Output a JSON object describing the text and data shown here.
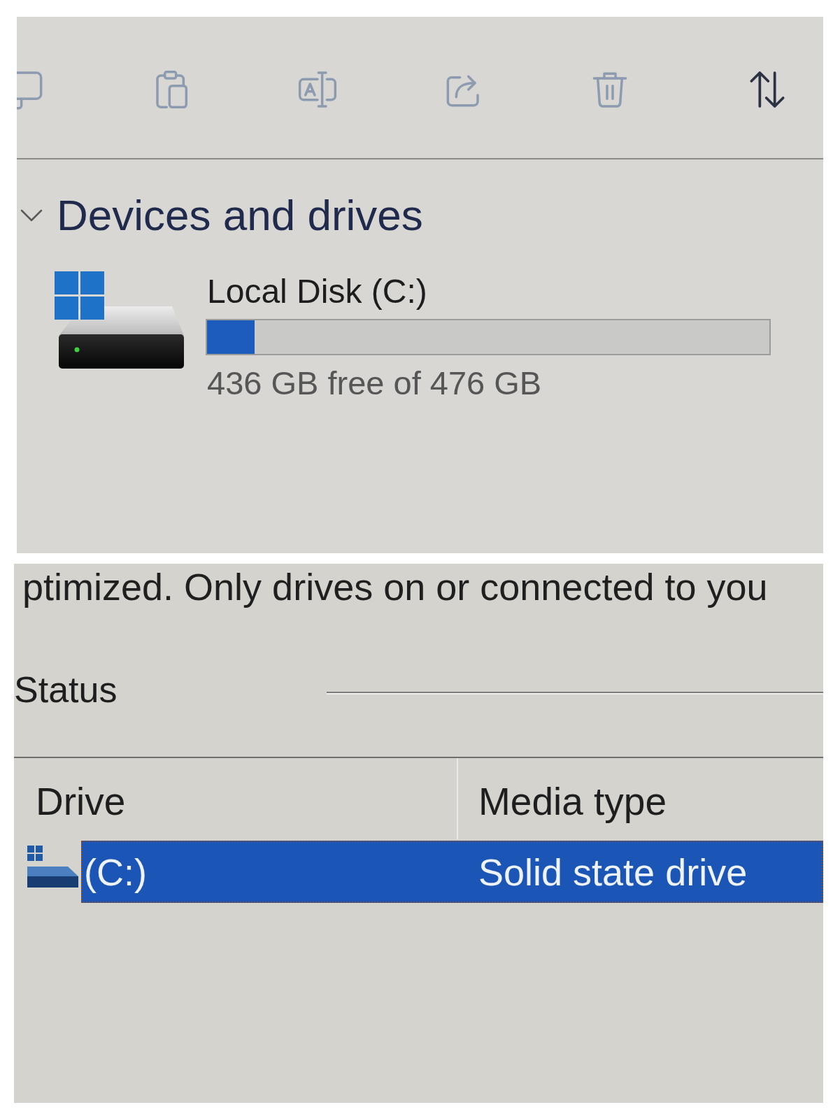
{
  "top_panel": {
    "toolbar": [
      {
        "kind": "copy",
        "disabled": true
      },
      {
        "kind": "paste",
        "disabled": true
      },
      {
        "kind": "rename",
        "disabled": true
      },
      {
        "kind": "share",
        "disabled": true
      },
      {
        "kind": "delete",
        "disabled": true
      },
      {
        "kind": "sort",
        "disabled": false
      }
    ],
    "section": {
      "title": "Devices and drives",
      "expanded": true,
      "drives": [
        {
          "name": "Local Disk (C:)",
          "level": 0.085,
          "free_space": "436 GB free of 476 GB"
        }
      ]
    }
  },
  "bottom_panel": {
    "description": "ptimized. Only drives on or connected to you",
    "status_label": "Status",
    "table": {
      "columns": [
        "Drive",
        "Media type"
      ],
      "rows": [
        {
          "cells": [
            "(C:)",
            "Solid state drive"
          ],
          "selected": true
        }
      ]
    }
  }
}
